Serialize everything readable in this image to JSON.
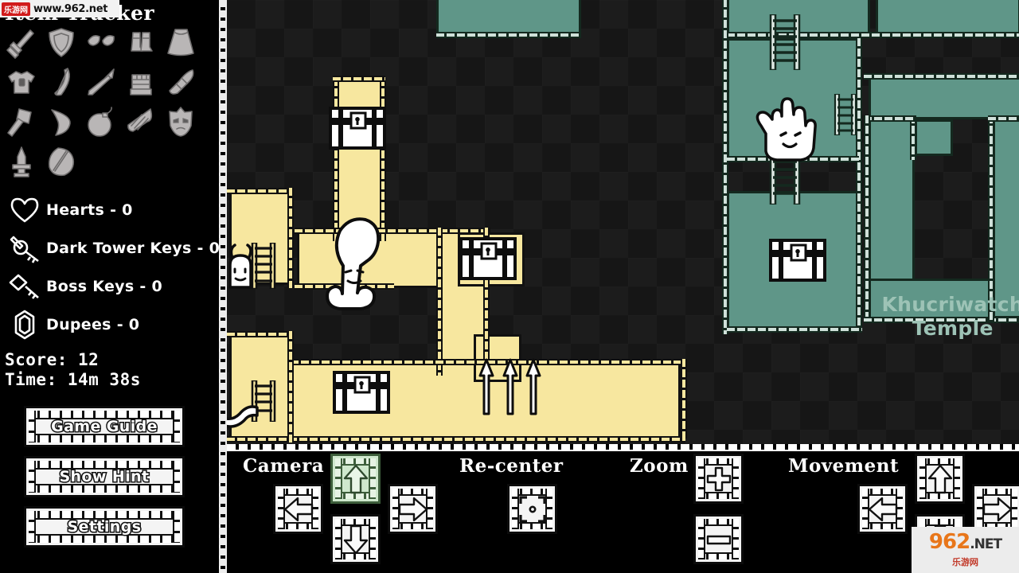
{
  "sidebar": {
    "title": "Item Tracker",
    "items": [
      {
        "name": "sword-item",
        "label": "Sword"
      },
      {
        "name": "shield-item",
        "label": "Shield"
      },
      {
        "name": "leaf-pair-item",
        "label": "Leaves"
      },
      {
        "name": "boots-item",
        "label": "Boots"
      },
      {
        "name": "cape-item",
        "label": "Cape"
      },
      {
        "name": "tunic-item",
        "label": "Tunic"
      },
      {
        "name": "bow-item",
        "label": "Bow"
      },
      {
        "name": "arrow-item",
        "label": "Arrow"
      },
      {
        "name": "gauntlet-item",
        "label": "Gauntlet"
      },
      {
        "name": "horn-item",
        "label": "Horn"
      },
      {
        "name": "hammer-item",
        "label": "Hammer"
      },
      {
        "name": "boomerang-item",
        "label": "Boomerang"
      },
      {
        "name": "bomb-item",
        "label": "Bomb"
      },
      {
        "name": "harp-item",
        "label": "Harp"
      },
      {
        "name": "mask-item",
        "label": "Mask"
      },
      {
        "name": "dagger-item",
        "label": "Dagger"
      },
      {
        "name": "mirror-shield-item",
        "label": "Mirror Shield"
      }
    ],
    "stats": [
      {
        "icon": "heart-icon",
        "text": "Hearts - 0"
      },
      {
        "icon": "dark-tower-key-icon",
        "text": "Dark Tower Keys - 0"
      },
      {
        "icon": "boss-key-icon",
        "text": "Boss Keys - 0"
      },
      {
        "icon": "gem-icon",
        "text": "Dupees - 0"
      }
    ],
    "score_line": "Score: 12",
    "time_line": "Time: 14m 38s",
    "buttons": [
      {
        "name": "game-guide-button",
        "label": "Game Guide"
      },
      {
        "name": "show-hint-button",
        "label": "Show Hint"
      },
      {
        "name": "settings-button",
        "label": "Settings"
      }
    ]
  },
  "map": {
    "region_label_line1": "Khucriwatch",
    "region_label_line2": "Temple",
    "colors": {
      "corridor": "#f7e79f",
      "temple": "#5f9688",
      "background": "#191919",
      "wall": "#111111",
      "label": "#9dc3b6",
      "highlight": "#cfe8cd"
    }
  },
  "controls": {
    "camera": {
      "label": "Camera",
      "up": "⇧",
      "down": "⇩",
      "left": "⇦",
      "right": "⇨",
      "active": "up"
    },
    "recenter": {
      "label": "Re-center",
      "icon": "recenter-icon"
    },
    "zoom": {
      "label": "Zoom",
      "plus": "+",
      "minus": "−"
    },
    "movement": {
      "label": "Movement",
      "up": "⇧",
      "down": "⇩",
      "left": "⇦",
      "right": "⇨"
    }
  },
  "watermarks": {
    "top": {
      "badge": "乐游网",
      "url": "www.962.net"
    },
    "bottom": {
      "num": "962",
      "dot": ".NET",
      "sub": "乐游网"
    }
  }
}
